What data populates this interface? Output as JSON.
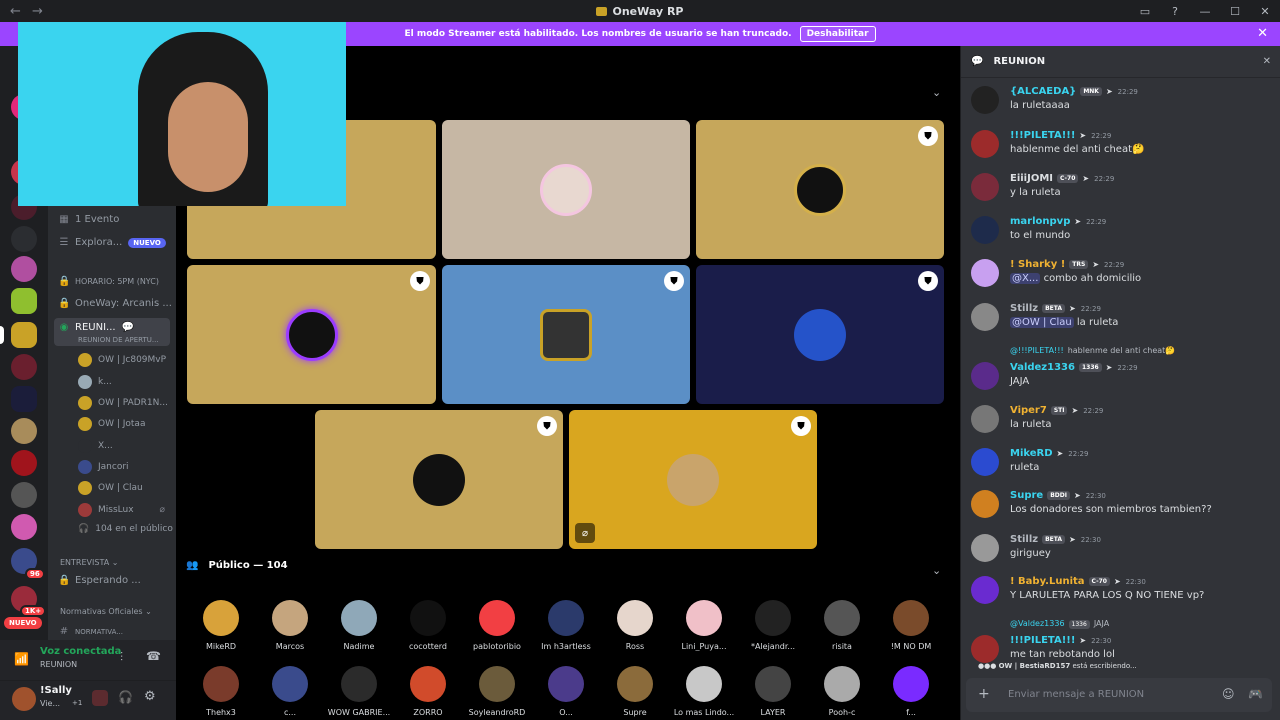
{
  "window": {
    "title": "OneWay RP",
    "back": "←",
    "forward": "→",
    "controls": [
      "▭",
      "?",
      "—",
      "☐",
      "✕"
    ]
  },
  "banner": {
    "text": "El modo Streamer está habilitado. Los nombres de usuario se han truncado.",
    "button": "Deshabilitar",
    "close": "✕"
  },
  "rail": {
    "badges": [
      "96",
      "1K+"
    ],
    "nuevo": "NUEVO"
  },
  "sidebar": {
    "events": "1 Evento",
    "explore": "Explora...",
    "explore_tag": "NUEVO",
    "schedule": "HORARIO: 5PM (NYC)",
    "arcanis": "OneWay: Arcanis ...",
    "stage_channel": "REUNI...",
    "stage_sub": "REUNION DE APERTU...",
    "voice_users": [
      "OW | Jc809MvP",
      "k...",
      "OW | PADR1N...",
      "OW | Jotaa",
      "X...",
      "Jancori",
      "OW | Clau",
      "MissLux"
    ],
    "audience_count": "104 en el público",
    "cat_interview": "ENTREVISTA",
    "waiting": "Esperando ...",
    "cat_rules": "Normativas Oficiales",
    "rules_channel": "NORMATIVA..."
  },
  "voice": {
    "status": "Voz conectada",
    "channel": "REUNION"
  },
  "user": {
    "name": "!Sally",
    "status": "Vie...",
    "extra": "+1"
  },
  "stage": {
    "speakers_hidden": [
      "",
      "",
      "",
      "",
      "",
      "",
      "",
      ""
    ],
    "audience_label": "Público — 104",
    "audience": [
      [
        "MikeRD",
        "Marcos",
        "Nadime",
        "cocotterd",
        "pablotoribio",
        "Im h3artless",
        "Ross",
        "Lini_Puya...",
        "*Alejandr...",
        "risita",
        "!M NO DM"
      ],
      [
        "Thehx3",
        "c...",
        "WOW GABRIE...",
        "ZORRO",
        "SoyleandroRD",
        "O...",
        "Supre",
        "Lo mas Lindo...",
        "LAYER",
        "Pooh-c",
        "f..."
      ]
    ]
  },
  "chat": {
    "title": "REUNION",
    "messages": [
      {
        "name": "{ALCAEDA}",
        "tag": "MNK",
        "time": "22:29",
        "text": "la ruletaaaa",
        "color": "#3ad4ef"
      },
      {
        "name": "!!!PILETA!!!",
        "tag": "",
        "time": "22:29",
        "text": "hablenme del anti cheat🤔",
        "color": "#3ad4ef"
      },
      {
        "name": "EiiiJOMI",
        "tag": "C-70",
        "time": "22:29",
        "text": "y la ruleta",
        "color": "#dbdee1"
      },
      {
        "name": "marlonpvp",
        "tag": "",
        "time": "22:29",
        "text": "to el mundo",
        "color": "#3ad4ef"
      },
      {
        "name": "! Sharky !",
        "tag": "TRS",
        "time": "22:29",
        "mention": "@X...",
        "text": "combo ah domicilio",
        "color": "#f0b232"
      },
      {
        "name": "Stillz",
        "tag": "BETA",
        "time": "22:29",
        "mention": "@OW | Clau",
        "text": "la ruleta",
        "color": "#b5bac1"
      },
      {
        "name": "Valdez1336",
        "tag": "1336",
        "time": "22:29",
        "text": "JAJA",
        "color": "#3ad4ef",
        "reply_name": "@!!!PILETA!!!",
        "reply_text": "hablenme del anti cheat🤔"
      },
      {
        "name": "Viper7",
        "tag": "STI",
        "time": "22:29",
        "text": "la ruleta",
        "color": "#f0b232"
      },
      {
        "name": "MikeRD",
        "tag": "",
        "time": "22:29",
        "text": "ruleta",
        "color": "#3ad4ef"
      },
      {
        "name": "Supre",
        "tag": "BDDI",
        "time": "22:30",
        "text": "Los donadores son miembros tambien??",
        "color": "#3ad4ef"
      },
      {
        "name": "Stillz",
        "tag": "BETA",
        "time": "22:30",
        "text": "giriguey",
        "color": "#b5bac1"
      },
      {
        "name": "! Baby.Lunita",
        "tag": "C-70",
        "time": "22:30",
        "text": "Y LARULETA PARA LOS Q NO TIENE vp?",
        "color": "#f0b232"
      },
      {
        "name": "!!!PILETA!!!",
        "tag": "",
        "time": "22:30",
        "text": "me tan rebotando lol",
        "color": "#3ad4ef",
        "reply_name": "@Valdez1336",
        "reply_tag": "1336",
        "reply_text": "JAJA"
      }
    ],
    "typing_name": "OW | BestiaRD157",
    "typing_text": "está escribiendo...",
    "placeholder": "Enviar mensaje a",
    "placeholder_channel": "REUNION"
  }
}
